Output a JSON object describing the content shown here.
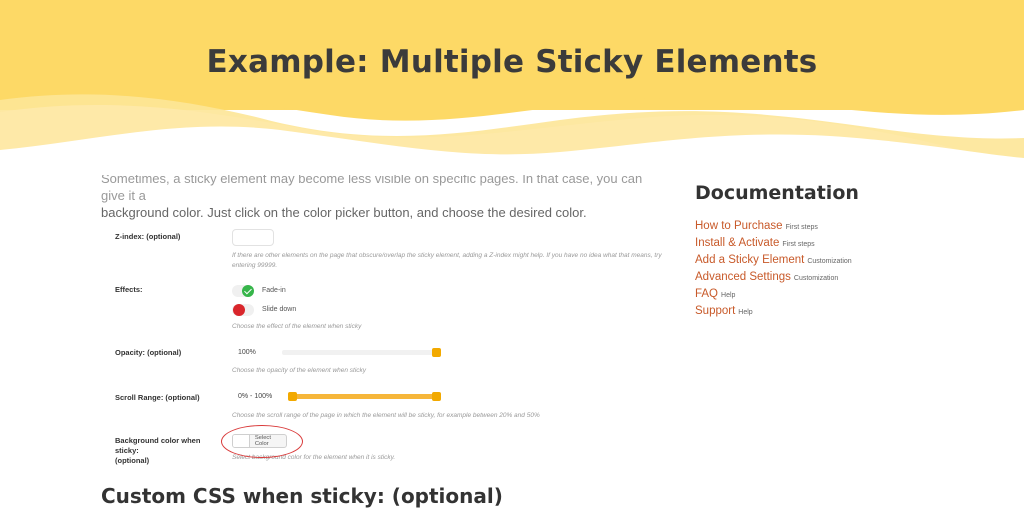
{
  "banner": {
    "title": "Example: Multiple Sticky Elements",
    "colors": {
      "back": "#fde08a",
      "mid": "#fdd970",
      "front": "#fce179"
    }
  },
  "intro": {
    "partial_line": "Sometimes, a sticky element may become less visible on specific pages. In that case, you can give it a",
    "line2": "background color. Just click on the color picker button, and choose the desired color."
  },
  "settings": {
    "zindex": {
      "label": "Z-index: (optional)",
      "value": "",
      "hint": "If there are other elements on the page that obscure/overlap the sticky element, adding a Z-index might help. If you have no idea what that means, try entering 99999."
    },
    "effects": {
      "label": "Effects:",
      "options": [
        {
          "label": "Fade-in",
          "enabled": true
        },
        {
          "label": "Slide down",
          "enabled": false
        }
      ],
      "hint": "Choose the effect of the element when sticky"
    },
    "opacity": {
      "label": "Opacity: (optional)",
      "value": "100%",
      "slider_value": 1.0,
      "hint": "Choose the opacity of the element when sticky"
    },
    "scroll_range": {
      "label": "Scroll Range: (optional)",
      "value": "0% - 100%",
      "range_start": 0,
      "range_end": 100,
      "hint": "Choose the scroll range of the page in which the element will be sticky, for example between 20% and 50%"
    },
    "background_color": {
      "label_line1": "Background color when sticky:",
      "label_line2": "(optional)",
      "button_label": "Select Color",
      "hint": "Select background color for the element when it is sticky."
    }
  },
  "custom_css_heading": "Custom CSS when sticky: (optional)",
  "sidebar": {
    "title": "Documentation",
    "items": [
      {
        "label": "How to Purchase",
        "tag": "First steps"
      },
      {
        "label": "Install & Activate",
        "tag": "First steps"
      },
      {
        "label": "Add a Sticky Element",
        "tag": "Customization"
      },
      {
        "label": "Advanced Settings",
        "tag": "Customization"
      },
      {
        "label": "FAQ",
        "tag": "Help"
      },
      {
        "label": "Support",
        "tag": "Help"
      }
    ]
  },
  "accent_colors": {
    "slider": "#f6b63a",
    "thumb": "#f2a900",
    "link": "#c85a2a",
    "highlight": "#d93a3a"
  }
}
